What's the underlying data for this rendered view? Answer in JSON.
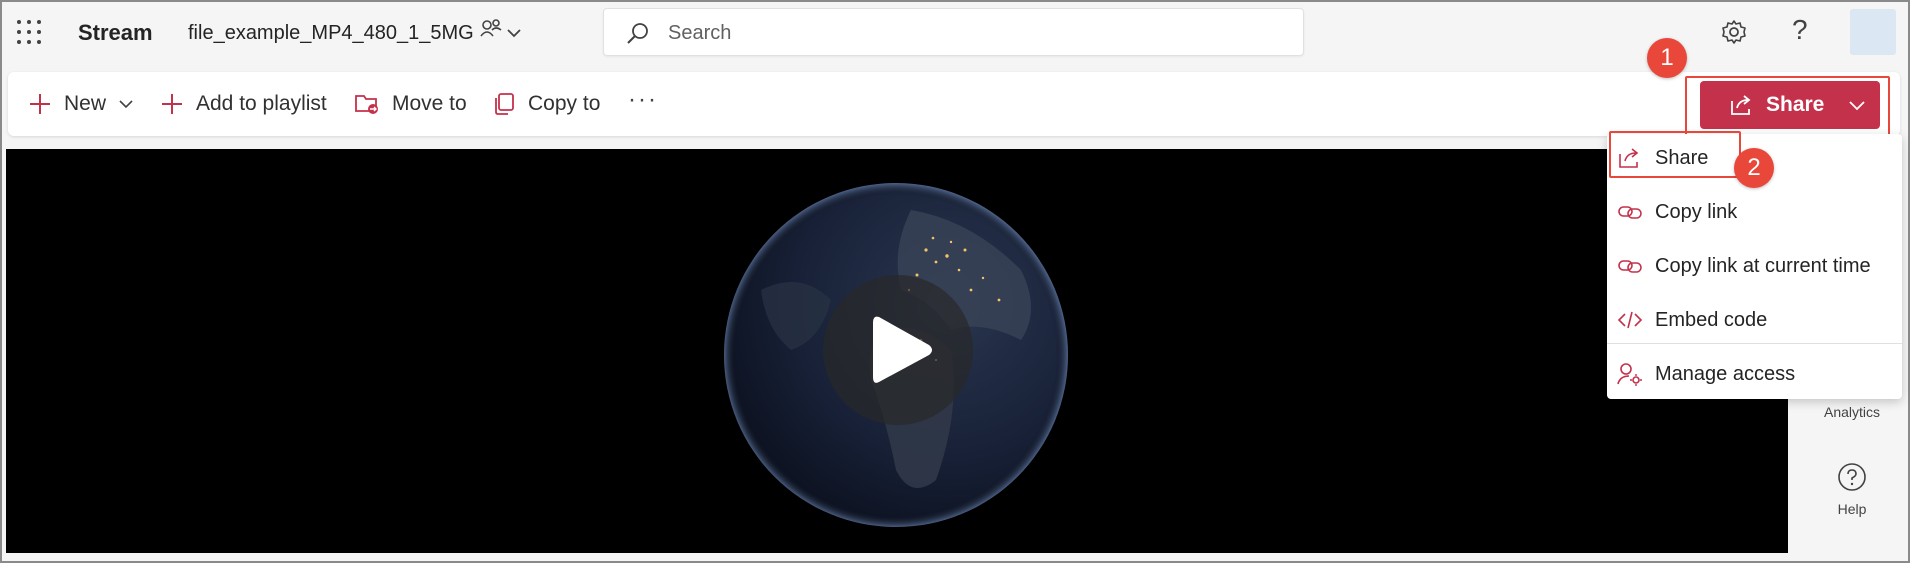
{
  "topbar": {
    "app_name": "Stream",
    "file_name": "file_example_MP4_480_1_5MG",
    "search_placeholder": "Search",
    "icons": [
      "waffle-icon",
      "people-icon",
      "chevron-down-icon",
      "search-icon",
      "gear-icon",
      "help-icon",
      "avatar"
    ],
    "help_glyph": "?"
  },
  "command_bar": {
    "new_label": "New",
    "add_to_playlist_label": "Add to playlist",
    "move_to_label": "Move to",
    "copy_to_label": "Copy to",
    "more_label": "···"
  },
  "share_button": {
    "label": "Share",
    "color": "#c4314b"
  },
  "callouts": {
    "step1": "1",
    "step2": "2",
    "color": "#e8473a"
  },
  "share_menu": {
    "items": [
      {
        "label": "Share",
        "icon": "share-icon"
      },
      {
        "label": "Copy link",
        "icon": "link-icon"
      },
      {
        "label": "Copy link at current time",
        "icon": "link-icon"
      },
      {
        "label": "Embed code",
        "icon": "code-icon"
      },
      {
        "label": "Manage access",
        "icon": "manage-access-icon"
      }
    ]
  },
  "right_rail": {
    "analytics_label": "Analytics",
    "help_label": "Help"
  },
  "video": {
    "state": "paused"
  }
}
